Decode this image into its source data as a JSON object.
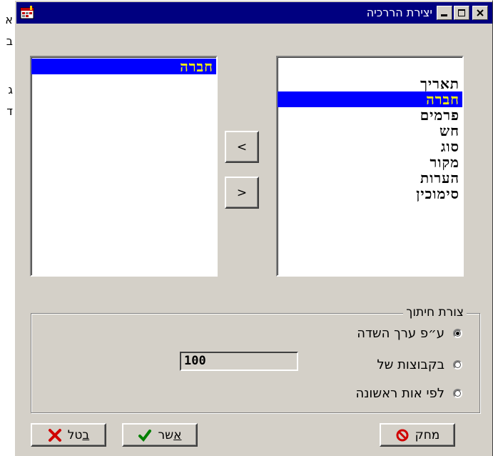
{
  "background_text": [
    "א",
    "ב",
    "ג",
    "ד"
  ],
  "window": {
    "title": "יצירת הררכיה",
    "buttons": {
      "minimize": "minimize-icon",
      "maximize": "maximize-icon",
      "close": "close-icon"
    }
  },
  "source_list": {
    "items": [
      "תאריך",
      "חברה",
      "פרמים",
      "חש",
      "סוג",
      "מקור",
      "הערות",
      "סימוכין"
    ],
    "selected_index": 1
  },
  "target_list": {
    "items": [
      "חברה"
    ],
    "selected_index": 0
  },
  "move_buttons": {
    "add_label": "<",
    "remove_label": ">"
  },
  "group": {
    "legend": "צורת חיתוך",
    "options": [
      {
        "label": "ע״פ ערך השדה",
        "checked": true
      },
      {
        "label": "בקבוצות של",
        "checked": false
      },
      {
        "label": "לפי אות ראשונה",
        "checked": false
      }
    ],
    "group_size_value": "100"
  },
  "footer": {
    "cancel": {
      "pre": "",
      "accel": "ב",
      "post": "טל",
      "icon": "x-icon"
    },
    "ok": {
      "pre": "",
      "accel": "א",
      "post": "שר",
      "icon": "check-icon"
    },
    "delete": {
      "label": "מחק",
      "icon": "no-entry-icon"
    }
  },
  "colors": {
    "title_bar": "#000080",
    "selection": "#0000ff",
    "selection_text": "#ffff00",
    "face": "#d4d0c8"
  }
}
